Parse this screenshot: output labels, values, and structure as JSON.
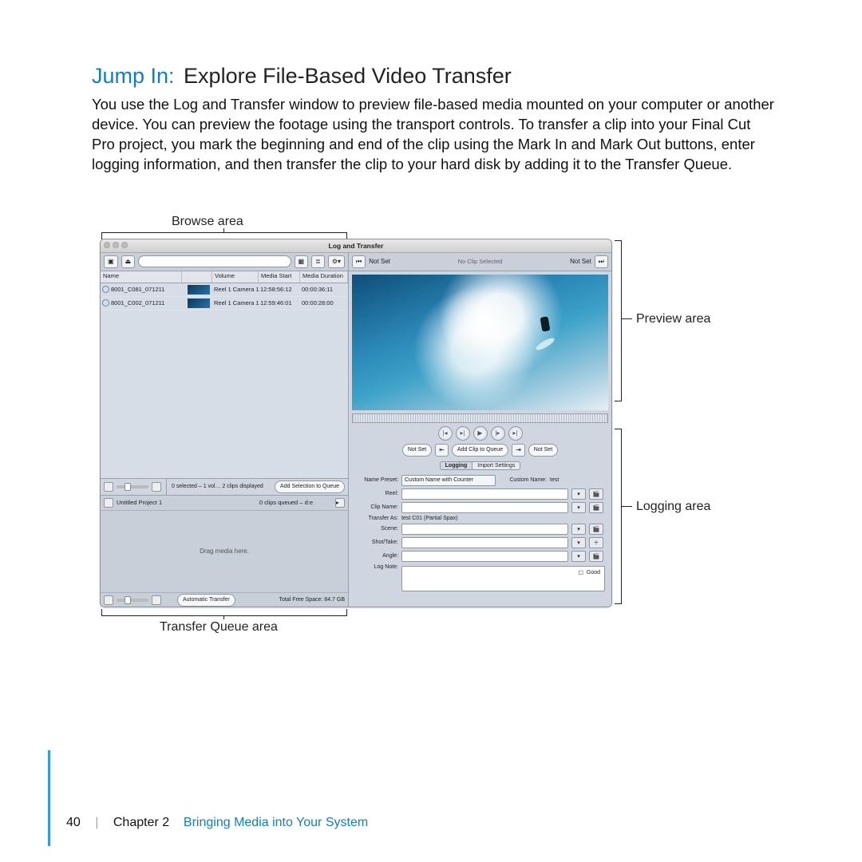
{
  "heading": {
    "prefix": "Jump In:",
    "rest": " Explore File-Based Video Transfer"
  },
  "body": "You use the Log and Transfer window to preview file-based media mounted on your computer or another device. You can preview the footage using the transport controls. To transfer a clip into your Final Cut Pro project, you mark the beginning and end of the clip using the Mark In and Mark Out buttons, enter logging information, and then transfer the clip to your hard disk by adding it to the Transfer Queue.",
  "callouts": {
    "browse": "Browse area",
    "preview": "Preview area",
    "logging": "Logging area",
    "queue": "Transfer Queue area"
  },
  "window": {
    "title": "Log and Transfer",
    "columns": {
      "name": "Name",
      "volume": "Volume",
      "mstart": "Media Start",
      "mdur": "Media Duration"
    },
    "rows": [
      {
        "name": "8001_C081_071211",
        "volume": "Reel 1 Camera 1",
        "mstart": "12:58:56:12",
        "mdur": "00:00:36:11"
      },
      {
        "name": "8001_C002_071211",
        "volume": "Reel 1 Camera 1",
        "mstart": "12:59:46:01",
        "mdur": "00:00:28:00"
      }
    ],
    "browse_footer": {
      "status": "0 selected – 1 vol… 2 clips displayed",
      "button": "Add Selection to Queue"
    },
    "queue": {
      "project": "Untitled Project 1",
      "status": "0 clips queued – d:e",
      "drop": "Drag media here.",
      "mode": "Automatic Transfer",
      "free": "Total Free Space: 84.7 GB"
    },
    "preview_header": {
      "left": "Not Set",
      "center": "No Clip Selected",
      "right": "Not Set"
    },
    "clipbar": {
      "left": "Not Set",
      "center": "Add Clip to Queue",
      "right": "Not Set"
    },
    "tabs": {
      "a": "Logging",
      "b": "Import Settings"
    },
    "log": {
      "preset_label": "Name Preset:",
      "preset_value": "Custom Name with Counter",
      "custom_name_label": "Custom Name:",
      "custom_name_value": "test",
      "reel": "Reel:",
      "clipname": "Clip Name:",
      "transfer_as_label": "Transfer As:",
      "transfer_as_value": "test C01 (Partial Spax)",
      "scene": "Scene:",
      "shot": "Shot/Take:",
      "angle": "Angle:",
      "lognote": "Log Note:",
      "good": "Good"
    }
  },
  "footer": {
    "page": "40",
    "chapter": "Chapter 2",
    "title": "Bringing Media into Your System"
  }
}
